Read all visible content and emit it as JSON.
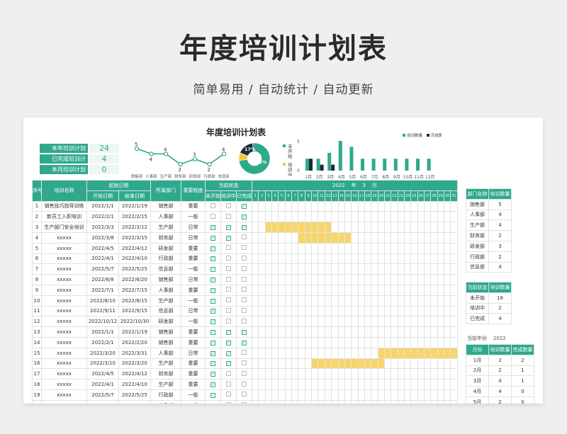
{
  "hero": {
    "title": "年度培训计划表",
    "subtitle": "简单易用 / 自动统计 / 自动更新"
  },
  "sheet": {
    "title": "年度培训计划表",
    "kpis": [
      {
        "label": "本年培训计划",
        "value": "24"
      },
      {
        "label": "已完成培训计",
        "value": "4"
      },
      {
        "label": "本月培训计划",
        "value": "0"
      }
    ],
    "line_chart": {
      "categories": [
        "销售部",
        "人事部",
        "生产部",
        "财务部",
        "研发部",
        "行政部",
        "信息部"
      ],
      "values": [
        5,
        4,
        4,
        2,
        3,
        2,
        4
      ]
    },
    "donut": {
      "slices": [
        {
          "name": "未开始",
          "label": "75%",
          "value": 75,
          "color": "#2fa98c"
        },
        {
          "name": "已完成",
          "label": "17%",
          "value": 17,
          "color": "#1e2a3a"
        },
        {
          "name": "培训中",
          "label": "",
          "value": 8,
          "color": "#f5c842"
        }
      ],
      "legend": [
        "未开始",
        "培训中"
      ]
    },
    "bar_chart": {
      "categories": [
        "1月",
        "2月",
        "3月",
        "4月",
        "5月",
        "6月",
        "7月",
        "8月",
        "9月",
        "10月",
        "11月",
        "12月"
      ],
      "series": [
        {
          "name": "培训数量",
          "values": [
            2,
            2,
            3,
            5,
            4,
            2,
            2,
            2,
            2,
            2,
            2,
            2
          ],
          "color": "#2fa98c"
        },
        {
          "name": "完成数量",
          "values": [
            2,
            1,
            1,
            0,
            0,
            0,
            0,
            0,
            0,
            0,
            0,
            0
          ],
          "color": "#1e2a3a"
        }
      ],
      "ymax_label": "5",
      "ymin_label": "0"
    },
    "table": {
      "headers": {
        "seq": "序号",
        "name": "培训名称",
        "start_group": "起始日期",
        "start": "开始日期",
        "end": "结束日期",
        "dept": "所属部门",
        "importance": "重要程度",
        "status_group": "当前状态",
        "s1": "未开始",
        "s2": "培训中",
        "s3": "已完成"
      },
      "gantt": {
        "year": "2022",
        "year_unit": "年",
        "month": "3",
        "month_unit": "月",
        "days": [
          "1",
          "2",
          "3",
          "4",
          "5",
          "6",
          "7",
          "8",
          "9",
          "10",
          "11",
          "12",
          "13",
          "14",
          "15",
          "16",
          "17",
          "18",
          "19",
          "20",
          "21",
          "22",
          "23",
          "24",
          "25",
          "26",
          "27",
          "28",
          "29",
          "30",
          "31"
        ]
      },
      "rows": [
        {
          "seq": "1",
          "name": "销售技巧指导训练",
          "start": "2022/1/1",
          "end": "2022/1/19",
          "dept": "销售部",
          "imp": "重要",
          "st": [
            0,
            0,
            1
          ]
        },
        {
          "seq": "2",
          "name": "新员工入职培训",
          "start": "2022/2/1",
          "end": "2022/2/15",
          "dept": "人事部",
          "imp": "一般",
          "st": [
            0,
            0,
            1
          ]
        },
        {
          "seq": "3",
          "name": "生产部门安全培训",
          "start": "2022/3/3",
          "end": "2022/3/12",
          "dept": "生产部",
          "imp": "日常",
          "st": [
            1,
            1,
            1
          ]
        },
        {
          "seq": "4",
          "name": "xxxxx",
          "start": "2022/3/8",
          "end": "2022/3/15",
          "dept": "财务部",
          "imp": "日常",
          "st": [
            1,
            1,
            0
          ]
        },
        {
          "seq": "5",
          "name": "xxxxx",
          "start": "2022/4/5",
          "end": "2022/4/12",
          "dept": "研发部",
          "imp": "重要",
          "st": [
            1,
            0,
            0
          ]
        },
        {
          "seq": "6",
          "name": "xxxxx",
          "start": "2022/4/1",
          "end": "2022/4/10",
          "dept": "行政部",
          "imp": "重要",
          "st": [
            1,
            0,
            0
          ]
        },
        {
          "seq": "7",
          "name": "xxxxx",
          "start": "2022/5/7",
          "end": "2022/5/25",
          "dept": "信息部",
          "imp": "一般",
          "st": [
            1,
            0,
            0
          ]
        },
        {
          "seq": "8",
          "name": "xxxxx",
          "start": "2022/6/8",
          "end": "2022/6/20",
          "dept": "销售部",
          "imp": "日常",
          "st": [
            1,
            0,
            0
          ]
        },
        {
          "seq": "9",
          "name": "xxxxx",
          "start": "2022/7/1",
          "end": "2022/7/15",
          "dept": "人事部",
          "imp": "重要",
          "st": [
            1,
            0,
            0
          ]
        },
        {
          "seq": "10",
          "name": "xxxxx",
          "start": "2022/8/10",
          "end": "2022/8/15",
          "dept": "生产部",
          "imp": "一般",
          "st": [
            1,
            0,
            0
          ]
        },
        {
          "seq": "11",
          "name": "xxxxx",
          "start": "2022/9/11",
          "end": "2022/9/15",
          "dept": "信息部",
          "imp": "日常",
          "st": [
            1,
            0,
            0
          ]
        },
        {
          "seq": "12",
          "name": "xxxxx",
          "start": "2022/10/12",
          "end": "2022/10/30",
          "dept": "研发部",
          "imp": "一般",
          "st": [
            1,
            0,
            0
          ]
        },
        {
          "seq": "13",
          "name": "xxxxx",
          "start": "2022/1/1",
          "end": "2022/1/19",
          "dept": "销售部",
          "imp": "重要",
          "st": [
            1,
            1,
            1
          ]
        },
        {
          "seq": "14",
          "name": "xxxxx",
          "start": "2022/2/1",
          "end": "2022/2/20",
          "dept": "销售部",
          "imp": "重要",
          "st": [
            1,
            1,
            1
          ]
        },
        {
          "seq": "15",
          "name": "xxxxx",
          "start": "2022/3/20",
          "end": "2022/3/31",
          "dept": "人事部",
          "imp": "日常",
          "st": [
            1,
            1,
            0
          ]
        },
        {
          "seq": "16",
          "name": "xxxxx",
          "start": "2022/3/10",
          "end": "2022/3/20",
          "dept": "生产部",
          "imp": "重要",
          "st": [
            1,
            1,
            0
          ]
        },
        {
          "seq": "17",
          "name": "xxxxx",
          "start": "2022/4/5",
          "end": "2022/4/12",
          "dept": "财务部",
          "imp": "重要",
          "st": [
            1,
            0,
            0
          ]
        },
        {
          "seq": "18",
          "name": "xxxxx",
          "start": "2022/4/1",
          "end": "2022/4/10",
          "dept": "生产部",
          "imp": "重要",
          "st": [
            1,
            0,
            0
          ]
        },
        {
          "seq": "19",
          "name": "xxxxx",
          "start": "2022/5/7",
          "end": "2022/5/25",
          "dept": "行政部",
          "imp": "一般",
          "st": [
            1,
            0,
            0
          ]
        },
        {
          "seq": "20",
          "name": "xxxxx",
          "start": "2022/6/8",
          "end": "2022/6/20",
          "dept": "信息部",
          "imp": "一般",
          "st": [
            1,
            0,
            0
          ]
        }
      ]
    },
    "dept_stats": {
      "headers": [
        "部门名称",
        "培训数量"
      ],
      "rows": [
        [
          "销售部",
          "5"
        ],
        [
          "人事部",
          "4"
        ],
        [
          "生产部",
          "4"
        ],
        [
          "财务部",
          "2"
        ],
        [
          "研发部",
          "3"
        ],
        [
          "行政部",
          "2"
        ],
        [
          "信息部",
          "4"
        ]
      ]
    },
    "status_stats": {
      "headers": [
        "当前状态",
        "培训数量"
      ],
      "rows": [
        [
          "未开始",
          "18"
        ],
        [
          "培训中",
          "2"
        ],
        [
          "已完成",
          "4"
        ]
      ]
    },
    "year_label": {
      "label": "当前年份",
      "value": "2022"
    },
    "month_stats": {
      "headers": [
        "月份",
        "培训数量",
        "完成数量"
      ],
      "rows": [
        [
          "1月",
          "2",
          "2"
        ],
        [
          "2月",
          "2",
          "1"
        ],
        [
          "3月",
          "4",
          "1"
        ],
        [
          "4月",
          "4",
          "0"
        ],
        [
          "5月",
          "2",
          "0"
        ]
      ]
    }
  }
}
